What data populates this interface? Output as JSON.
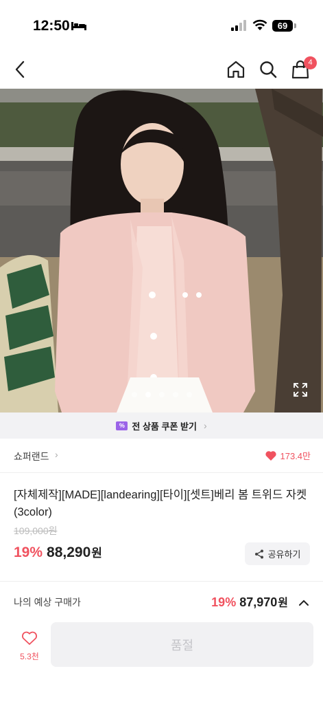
{
  "status_bar": {
    "time": "12:50",
    "battery": "69"
  },
  "nav": {
    "cart_badge": "4",
    "icons": [
      "back-icon",
      "home-icon",
      "search-icon",
      "shopping-bag-icon"
    ]
  },
  "coupon": {
    "label": "전 상품 쿠폰 받기"
  },
  "shop": {
    "name": "쇼퍼랜드",
    "likes": "173.4만"
  },
  "product": {
    "title": "[자체제작][MADE][landearing][타이][셋트]베리 봄 트위드 자켓 (3color)",
    "original_price": "109,000원",
    "discount": "19%",
    "price": "88,290",
    "currency": "원",
    "share_label": "공유하기",
    "image_count": 5,
    "image_index": 2
  },
  "estimate": {
    "label": "나의 예상 구매가",
    "discount": "19%",
    "price": "87,970",
    "currency": "원"
  },
  "bottom": {
    "wish_count": "5.3천",
    "buy_label": "품절"
  },
  "colors": {
    "accent": "#f0525f",
    "coupon": "#9b64e8"
  }
}
